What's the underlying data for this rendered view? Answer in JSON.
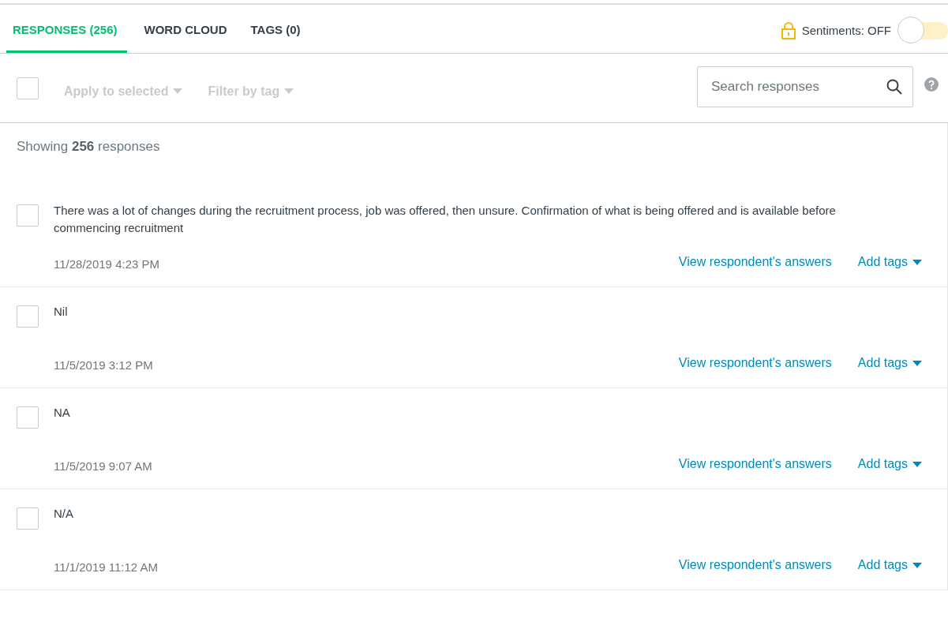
{
  "tabs": [
    {
      "label": "RESPONSES (256)",
      "selected": true
    },
    {
      "label": "WORD CLOUD",
      "selected": false
    },
    {
      "label": "TAGS (0)",
      "selected": false
    }
  ],
  "sentiments": {
    "label": "Sentiments: OFF",
    "on": false,
    "locked": true
  },
  "toolbar": {
    "select_all_checked": false,
    "actions": [
      {
        "label": "Apply to selected",
        "disabled": true
      },
      {
        "label": "Filter by tag",
        "disabled": true
      }
    ],
    "search": {
      "placeholder": "Search responses"
    }
  },
  "summary": "Showing **256** responses",
  "responses": [
    {
      "text": "There was a lot of changes during the recruitment process, job was offered, then unsure. Confirmation of what is being offered and is available before commencing recruitment",
      "date": "11/28/2019 4:23 PM",
      "checked": false,
      "link": "View respondent's answers",
      "tags": "Add tags"
    },
    {
      "text": "Nil",
      "date": "11/5/2019 3:12 PM",
      "checked": false,
      "link": "View respondent's answers",
      "tags": "Add tags"
    },
    {
      "text": "NA",
      "date": "11/5/2019 9:07 AM",
      "checked": false,
      "link": "View respondent's answers",
      "tags": "Add tags"
    },
    {
      "text": "N/A",
      "date": "11/1/2019 11:12 AM",
      "checked": false,
      "link": "View respondent's answers",
      "tags": "Add tags"
    }
  ]
}
